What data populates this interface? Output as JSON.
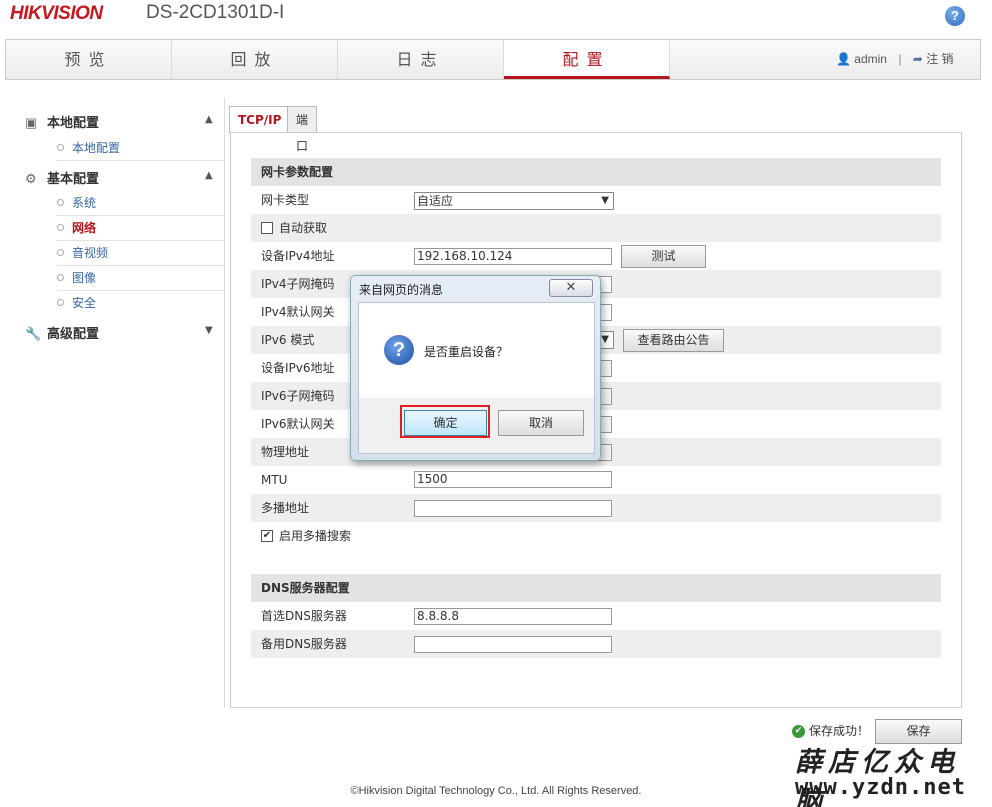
{
  "header": {
    "brand": "HIKVISION",
    "model": "DS-2CD1301D-I",
    "help_label": "?"
  },
  "nav": {
    "tabs": [
      {
        "label": "预览"
      },
      {
        "label": "回放"
      },
      {
        "label": "日志"
      },
      {
        "label": "配置",
        "active": true
      }
    ],
    "user": "admin",
    "separator": "|",
    "logout": "注 销"
  },
  "sidebar": {
    "groups": [
      {
        "label": "本地配置",
        "icon": "monitor-icon",
        "expanded": true,
        "items": [
          "本地配置"
        ]
      },
      {
        "label": "基本配置",
        "icon": "gear-icon",
        "expanded": true,
        "items": [
          "系统",
          "网络",
          "音视频",
          "图像",
          "安全"
        ],
        "active_item": "网络"
      },
      {
        "label": "高级配置",
        "icon": "wrench-icon",
        "expanded": false,
        "items": []
      }
    ]
  },
  "content": {
    "tabs": [
      {
        "label": "TCP/IP",
        "active": true
      },
      {
        "label": "端口"
      }
    ],
    "nic": {
      "section_title": "网卡参数配置",
      "nic_type_label": "网卡类型",
      "nic_type_value": "自适应",
      "auto_obtain_label": "自动获取",
      "auto_obtain_checked": false,
      "ipv4_label": "设备IPv4地址",
      "ipv4_value": "192.168.10.124",
      "test_button": "测试",
      "ipv4_mask_label": "IPv4子网掩码",
      "ipv4_gw_label": "IPv4默认网关",
      "ipv6_mode_label": "IPv6 模式",
      "route_button": "查看路由公告",
      "ipv6_addr_label": "设备IPv6地址",
      "ipv6_mask_label": "IPv6子网掩码",
      "ipv6_gw_label": "IPv6默认网关",
      "mac_label": "物理地址",
      "mtu_label": "MTU",
      "mtu_value": "1500",
      "multicast_label": "多播地址",
      "multicast_value": "",
      "multicast_search_label": "启用多播搜索",
      "multicast_search_checked": true
    },
    "dns": {
      "section_title": "DNS服务器配置",
      "preferred_label": "首选DNS服务器",
      "preferred_value": "8.8.8.8",
      "alternate_label": "备用DNS服务器",
      "alternate_value": ""
    },
    "save_status": "保存成功！",
    "save_button": "保存"
  },
  "dialog": {
    "title": "来自网页的消息",
    "close_label": "✕",
    "message": "是否重启设备？",
    "ok_button": "确定",
    "cancel_button": "取消"
  },
  "footer": {
    "copyright": "©Hikvision Digital Technology Co., Ltd. All Rights Reserved."
  },
  "watermark": {
    "line1": "薛店亿众电脑",
    "line2": "www.yzdn.net"
  },
  "colors": {
    "brand_red": "#c8171e",
    "active_red": "#b5161e",
    "link_blue": "#3667a6",
    "highlight_box": "#e02020"
  }
}
